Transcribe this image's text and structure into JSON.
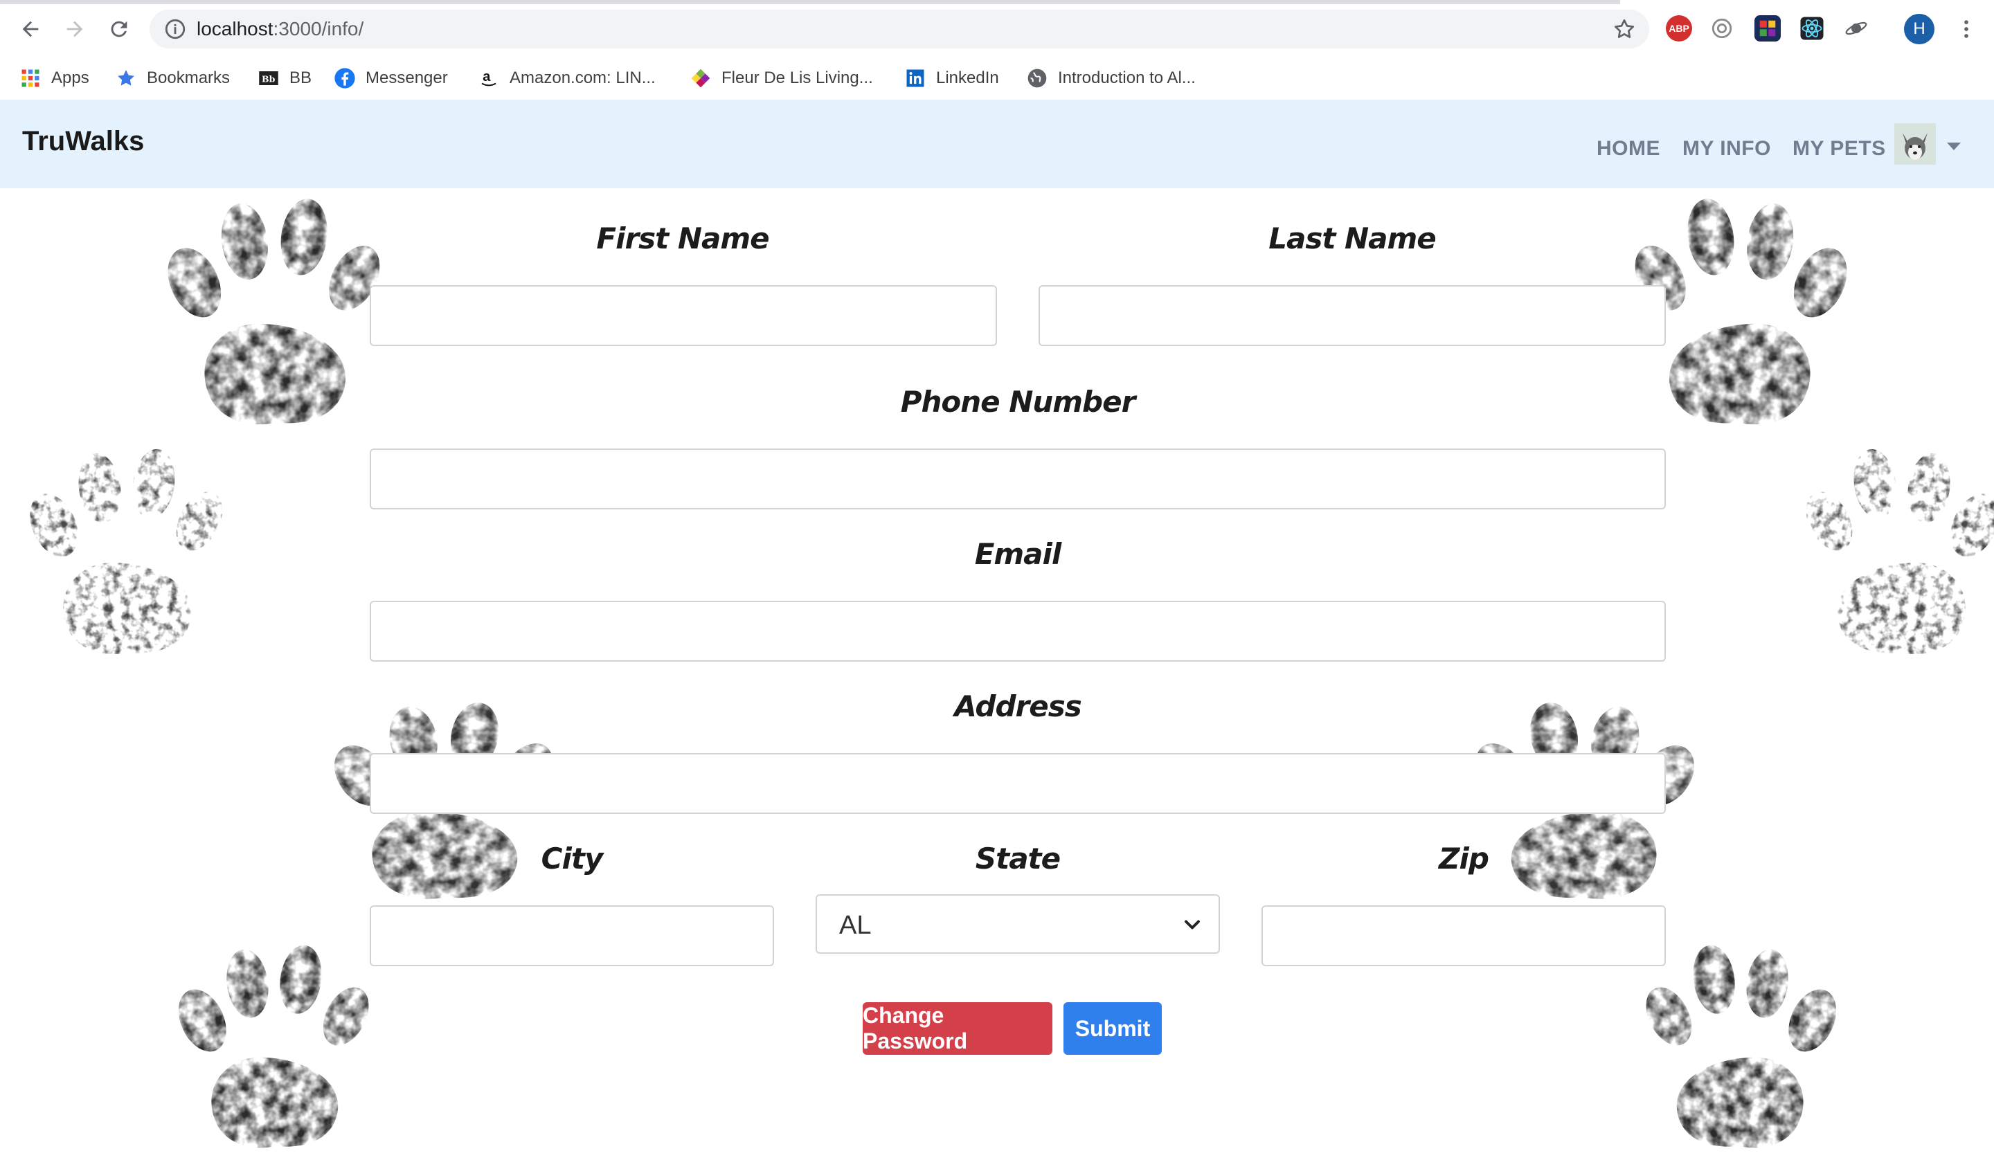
{
  "browser": {
    "url_host": "localhost",
    "url_path": ":3000/info/",
    "profile_initial": "H",
    "bookmarks": [
      {
        "label": "Apps",
        "icon": "apps-grid-icon"
      },
      {
        "label": "Bookmarks",
        "icon": "star-icon"
      },
      {
        "label": "BB",
        "icon": "blackboard-icon"
      },
      {
        "label": "Messenger",
        "icon": "facebook-icon"
      },
      {
        "label": "Amazon.com: LIN...",
        "icon": "amazon-icon"
      },
      {
        "label": "Fleur De Lis Living...",
        "icon": "fleur-icon"
      },
      {
        "label": "LinkedIn",
        "icon": "linkedin-icon"
      },
      {
        "label": "Introduction to Al...",
        "icon": "globe-icon"
      }
    ],
    "extensions": [
      {
        "name": "adblock-plus-icon",
        "text": "ABP",
        "color": "#d32f2f"
      },
      {
        "name": "extension-gray-icon",
        "text": "",
        "color": "#ffffff"
      },
      {
        "name": "extension-colorful-icon",
        "text": "",
        "color": "#1b2c5a"
      },
      {
        "name": "react-devtools-icon",
        "text": "",
        "color": "#ffffff"
      },
      {
        "name": "extension-planet-icon",
        "text": "",
        "color": "#ffffff"
      }
    ]
  },
  "app": {
    "brand": "TruWalks",
    "nav": {
      "home": "HOME",
      "my_info": "MY INFO",
      "my_pets": "MY PETS"
    },
    "colors": {
      "navbar_bg": "#e3f2fd",
      "danger": "#d3404a",
      "primary": "#2f80ed"
    }
  },
  "form": {
    "first_name": {
      "label": "First Name",
      "value": ""
    },
    "last_name": {
      "label": "Last Name",
      "value": ""
    },
    "phone": {
      "label": "Phone Number",
      "value": ""
    },
    "email": {
      "label": "Email",
      "value": ""
    },
    "address": {
      "label": "Address",
      "value": ""
    },
    "city": {
      "label": "City",
      "value": ""
    },
    "state": {
      "label": "State",
      "value": "AL"
    },
    "zip": {
      "label": "Zip",
      "value": ""
    },
    "change_password": "Change Password",
    "submit": "Submit"
  }
}
